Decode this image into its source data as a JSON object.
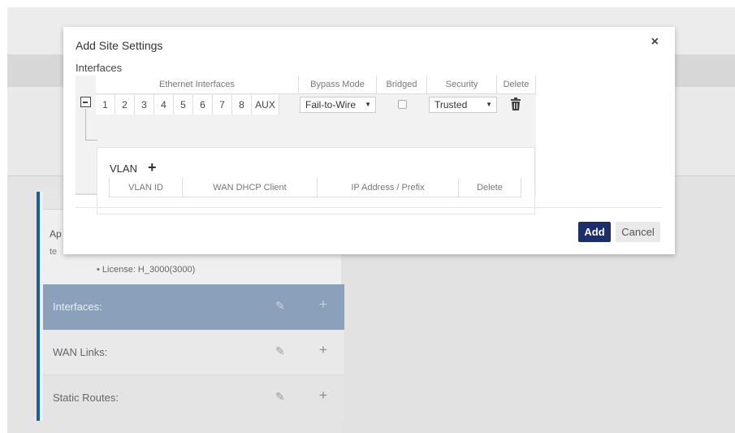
{
  "background": {
    "app_label": "Ap",
    "text_line_2": "te",
    "license_label": "• License: H_3000(3000)",
    "rows": {
      "interfaces": "Interfaces:",
      "wan_links": "WAN Links:",
      "static_routes": "Static Routes:"
    },
    "plus_symbol": "+"
  },
  "modal": {
    "title": "Add Site Settings",
    "close_symbol": "×",
    "section_label": "Interfaces",
    "headers": {
      "ethernet": "Ethernet Interfaces",
      "bypass": "Bypass Mode",
      "bridged": "Bridged",
      "security": "Security",
      "delete": "Delete"
    },
    "ports": [
      "1",
      "2",
      "3",
      "4",
      "5",
      "6",
      "7",
      "8",
      "AUX"
    ],
    "bypass_value": "Fail-to-Wire",
    "security_value": "Trusted",
    "bridged_checked": false,
    "vlan": {
      "label": "VLAN",
      "add_symbol": "+",
      "columns": {
        "vlan_id": "VLAN ID",
        "wan_dhcp": "WAN DHCP Client",
        "ip_prefix": "IP Address / Prefix",
        "delete": "Delete"
      }
    },
    "buttons": {
      "add": "Add",
      "cancel": "Cancel"
    }
  },
  "colors": {
    "primary_button": "#1c2f6b",
    "panel_accent": "#1b5f9e",
    "selected_row": "#8aa0bb"
  }
}
